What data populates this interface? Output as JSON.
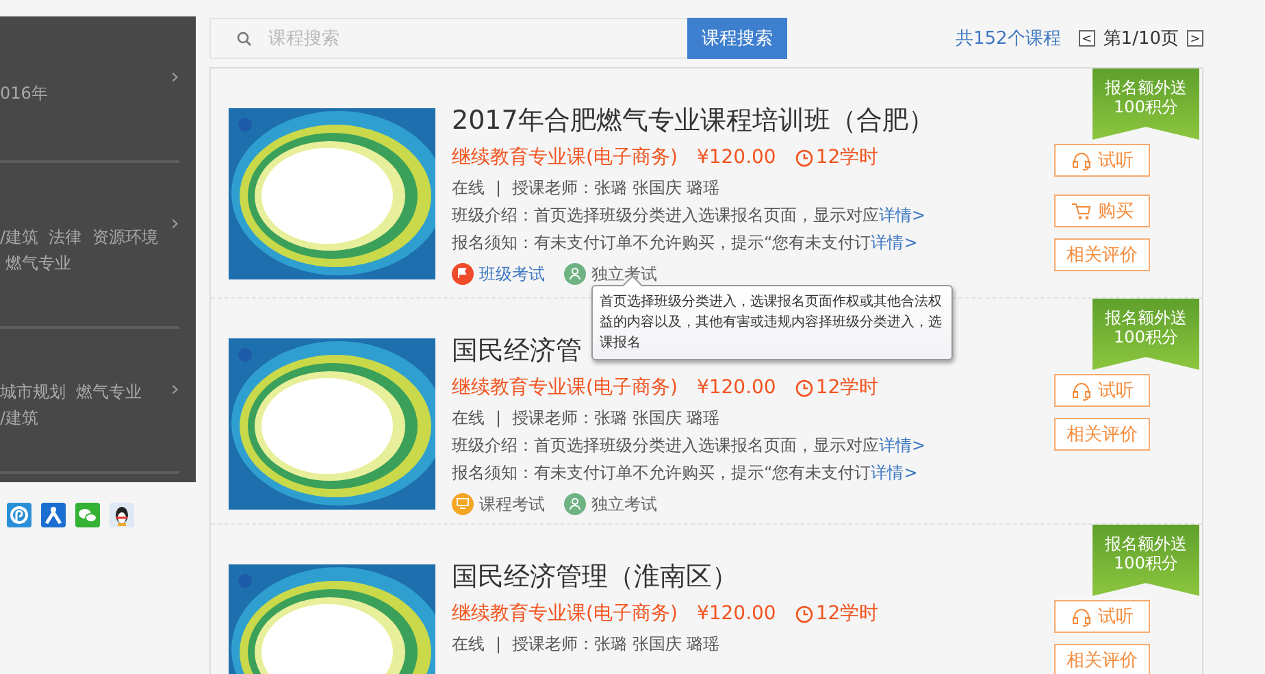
{
  "sidebar": {
    "items": [
      {
        "lines": [
          "016年"
        ],
        "chevron": "›"
      },
      {
        "lines": [
          "/建筑  法律  资源环境",
          " 燃气专业"
        ],
        "chevron": "›"
      },
      {
        "lines": [
          "城市规划  燃气专业",
          "/建筑"
        ],
        "chevron": "›"
      }
    ],
    "share_icons": [
      {
        "kind": "swirl"
      },
      {
        "kind": "person"
      },
      {
        "kind": "chat"
      },
      {
        "kind": "penguin"
      }
    ]
  },
  "search": {
    "placeholder": "课程搜索",
    "button": "课程搜索"
  },
  "pager": {
    "total": "共152个课程",
    "prev": "<",
    "page": "第1/10页",
    "next": ">"
  },
  "courses": [
    {
      "title": "2017年合肥燃气专业课程培训班（合肥）",
      "category": "继续教育专业课(电子商务)",
      "price": "¥120.00",
      "hours": "12学时",
      "mode": "在线",
      "separator": "|",
      "teachers": "授课老师：张璐  张国庆  璐瑶",
      "intro": "班级介绍：首页选择班级分类进入选课报名页面，显示对应",
      "intro_more": "详情>",
      "notice": "报名须知：有未支付订单不允许购买，提示“您有未支付订",
      "notice_more": "详情>",
      "ribbon": [
        "报名额外送",
        "100积分"
      ],
      "exams": [
        {
          "kind": "class",
          "label": "班级考试"
        },
        {
          "kind": "independent",
          "label": "独立考试"
        }
      ],
      "actions": [
        {
          "kind": "listen",
          "label": "试听"
        },
        {
          "kind": "buy",
          "label": "购买"
        },
        {
          "kind": "review",
          "label": "相关评价"
        }
      ]
    },
    {
      "title": "国民经济管",
      "category": "继续教育专业课(电子商务)",
      "price": "¥120.00",
      "hours": "12学时",
      "mode": "在线",
      "separator": "|",
      "teachers": "授课老师：张璐  张国庆  璐瑶",
      "intro": "班级介绍：首页选择班级分类进入选课报名页面，显示对应",
      "intro_more": "详情>",
      "notice": "报名须知：有未支付订单不允许购买，提示“您有未支付订",
      "notice_more": "详情>",
      "ribbon": [
        "报名额外送",
        "100积分"
      ],
      "exams": [
        {
          "kind": "course",
          "label": "课程考试"
        },
        {
          "kind": "independent",
          "label": "独立考试"
        }
      ],
      "actions": [
        {
          "kind": "listen",
          "label": "试听"
        },
        {
          "kind": "review",
          "label": "相关评价"
        }
      ]
    },
    {
      "title": "国民经济管理（淮南区）",
      "category": "继续教育专业课(电子商务)",
      "price": "¥120.00",
      "hours": "12学时",
      "mode": "在线",
      "separator": "|",
      "teachers": "授课老师：张璐  张国庆  璐瑶",
      "ribbon": [
        "报名额外送",
        "100积分"
      ],
      "actions": [
        {
          "kind": "listen",
          "label": "试听"
        },
        {
          "kind": "review",
          "label": "相关评价"
        }
      ]
    }
  ],
  "tooltip": {
    "text": "首页选择班级分类进入，选课报名页面作权或其他合法权益的内容以及，其他有害或违规内容择班级分类进入，选课报名"
  }
}
